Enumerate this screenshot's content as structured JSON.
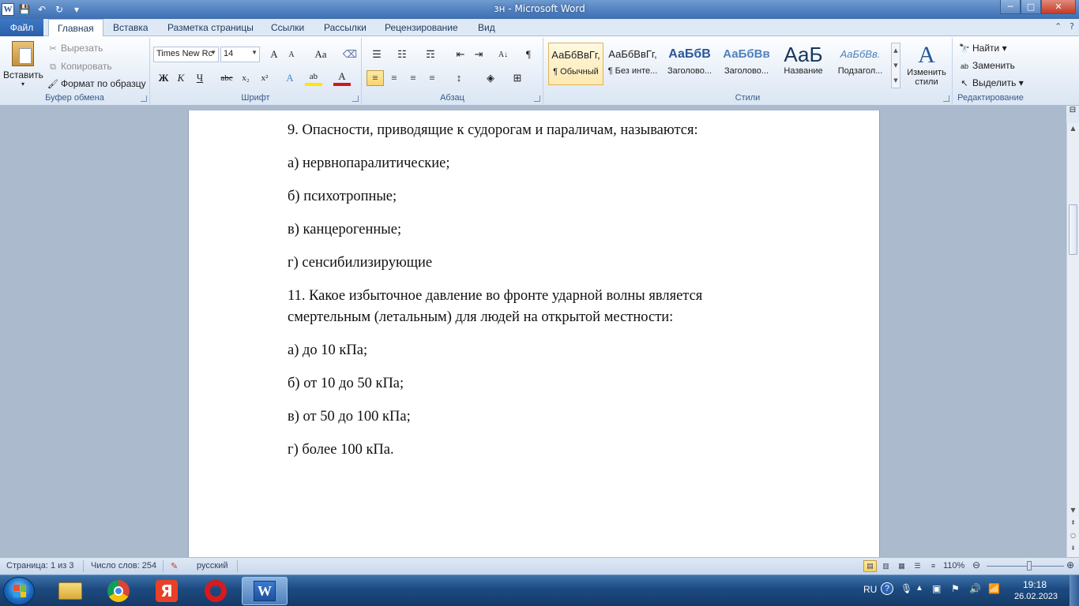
{
  "window": {
    "title": "зн  -  Microsoft Word",
    "app_icon": "W",
    "minimize": "─",
    "maximize": "□",
    "close": "✕"
  },
  "qat": {
    "save_icon": "💾",
    "undo_icon": "↶",
    "redo_icon": "↻",
    "customize_icon": "▾"
  },
  "tabs": {
    "file": "Файл",
    "home": "Главная",
    "insert": "Вставка",
    "page_layout": "Разметка страницы",
    "references": "Ссылки",
    "mailings": "Рассылки",
    "review": "Рецензирование",
    "view": "Вид",
    "minimize_ribbon_icon": "⌃",
    "help_icon": "?"
  },
  "clipboard": {
    "paste": "Вставить",
    "cut": "Вырезать",
    "copy": "Копировать",
    "format_painter": "Формат по образцу",
    "label": "Буфер обмена"
  },
  "font": {
    "name": "Times New Rc",
    "size": "14",
    "grow": "A",
    "shrink": "A",
    "case": "Aa",
    "clear": "⌫",
    "bold": "Ж",
    "italic": "К",
    "underline": "Ч",
    "strike": "abc",
    "subscript": "x₂",
    "superscript": "x²",
    "effects": "A",
    "highlight": "ab",
    "color": "A",
    "label": "Шрифт"
  },
  "paragraph": {
    "bullets": "☰",
    "numbering": "☷",
    "multilevel": "☶",
    "decrease_indent": "⇤",
    "increase_indent": "⇥",
    "sort": "A↓",
    "pilcrow": "¶",
    "align_left": "≡",
    "align_center": "≡",
    "align_right": "≡",
    "justify": "≡",
    "spacing": "↕",
    "shading": "◈",
    "borders": "⊞",
    "label": "Абзац"
  },
  "styles": {
    "items": [
      {
        "preview": "АаБбВвГг,",
        "name": "¶ Обычный"
      },
      {
        "preview": "АаБбВвГг,",
        "name": "¶ Без инте..."
      },
      {
        "preview": "АаБбВ",
        "name": "Заголово..."
      },
      {
        "preview": "АаБбВв",
        "name": "Заголово..."
      },
      {
        "preview": "АаБ",
        "name": "Название"
      },
      {
        "preview": "АаБбВв.",
        "name": "Подзагол..."
      }
    ],
    "change_styles": "Изменить стили",
    "label": "Стили",
    "accent": "#2a5699"
  },
  "editing": {
    "find": "Найти",
    "replace": "Заменить",
    "select": "Выделить",
    "label": "Редактирование"
  },
  "document": {
    "paragraphs": [
      "9. Опасности, приводящие к судорогам и параличам, называются:",
      "а) нервнопаралитические;",
      "б) психотропные;",
      "в) канцерогенные;",
      "г) сенсибилизирующие",
      "11. Какое избыточное давление во фронте ударной волны является смертельным (летальным) для людей на открытой местности:",
      "а) до 10 кПа;",
      "б) от 10 до 50 кПа;",
      "в) от 50 до 100 кПа;",
      "г) более 100 кПа."
    ]
  },
  "status": {
    "page": "Страница: 1 из 3",
    "words": "Число слов: 254",
    "language": "русский",
    "zoom": "110%",
    "zoom_value": 110
  },
  "taskbar": {
    "language": "RU",
    "time": "19:18",
    "date": "26.02.2023",
    "yandex": "Я"
  }
}
